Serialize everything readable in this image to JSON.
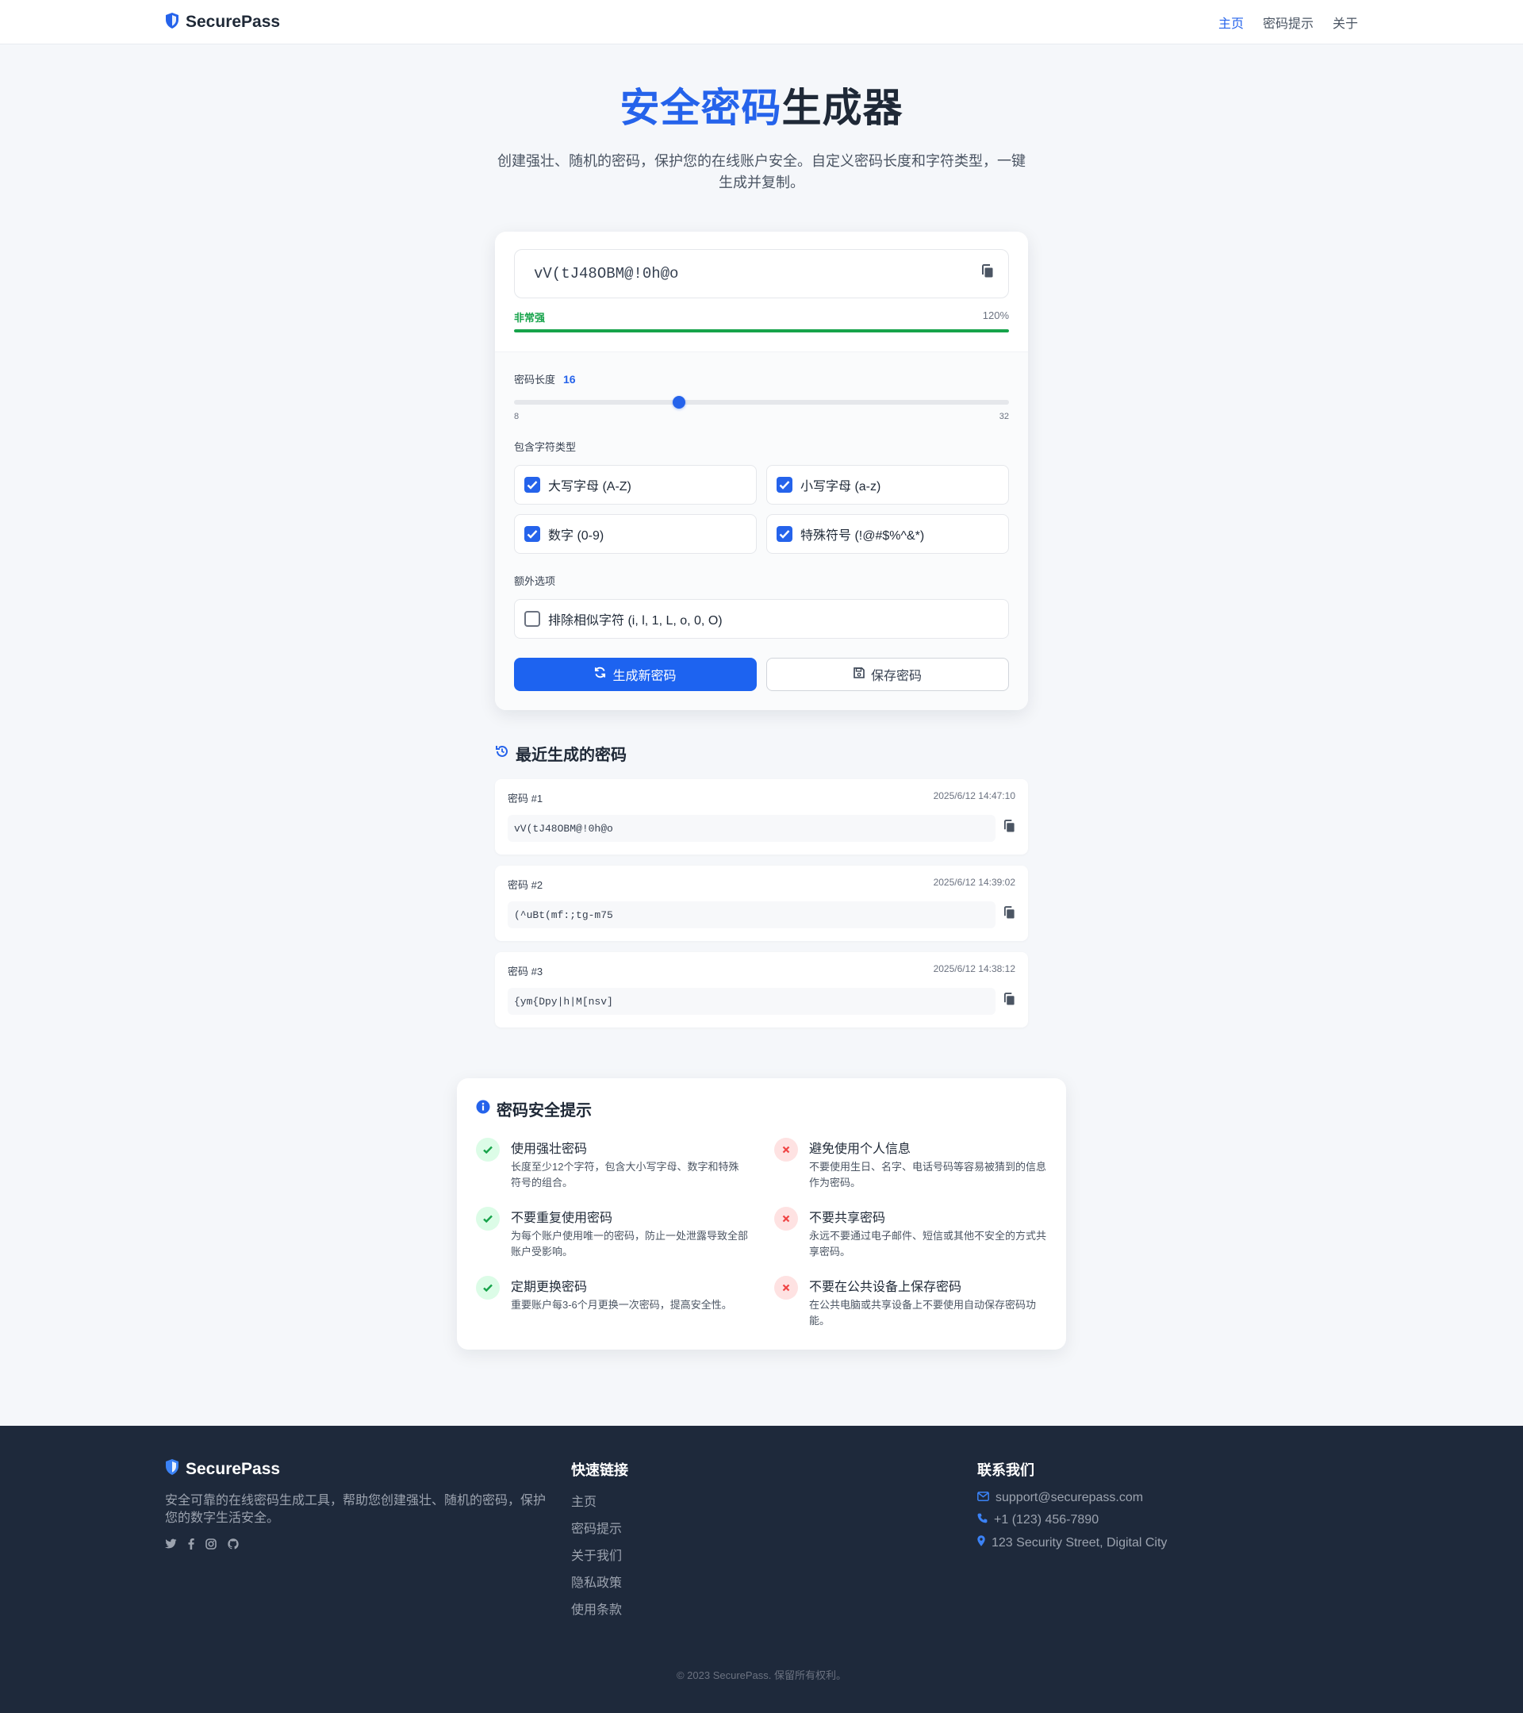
{
  "header": {
    "brand": "SecurePass",
    "nav": [
      {
        "label": "主页"
      },
      {
        "label": "密码提示"
      },
      {
        "label": "关于"
      }
    ]
  },
  "hero": {
    "title_highlight": "安全密码",
    "title_rest": "生成器",
    "subtitle": "创建强壮、随机的密码，保护您的在线账户安全。自定义密码长度和字符类型，一键生成并复制。"
  },
  "generator": {
    "password": "vV(tJ48OBM@!0h@o",
    "strength_label": "非常强",
    "strength_percent": "120%",
    "strength_fill_fraction": 1.0,
    "length_label": "密码长度",
    "length_value": "16",
    "length_min": "8",
    "length_max": "32",
    "charset_label": "包含字符类型",
    "options": [
      {
        "label": "大写字母 (A-Z)",
        "checked": true
      },
      {
        "label": "小写字母 (a-z)",
        "checked": true
      },
      {
        "label": "数字 (0-9)",
        "checked": true
      },
      {
        "label": "特殊符号 (!@#$%^&*)",
        "checked": true
      }
    ],
    "extra_label": "额外选项",
    "extra_option": {
      "label": "排除相似字符 (i, l, 1, L, o, 0, O)",
      "checked": false
    },
    "generate_label": "生成新密码",
    "save_label": "保存密码"
  },
  "recent": {
    "title": "最近生成的密码",
    "items": [
      {
        "name": "密码 #1",
        "time": "2025/6/12 14:47:10",
        "password": "vV(tJ48OBM@!0h@o"
      },
      {
        "name": "密码 #2",
        "time": "2025/6/12 14:39:02",
        "password": "(^uBt(mf:;tg-m75"
      },
      {
        "name": "密码 #3",
        "time": "2025/6/12 14:38:12",
        "password": "{ym{Dpy|h|M[nsv]"
      }
    ]
  },
  "tips": {
    "title": "密码安全提示",
    "items": [
      {
        "type": "good",
        "head": "使用强壮密码",
        "desc": "长度至少12个字符，包含大小写字母、数字和特殊符号的组合。"
      },
      {
        "type": "bad",
        "head": "避免使用个人信息",
        "desc": "不要使用生日、名字、电话号码等容易被猜到的信息作为密码。"
      },
      {
        "type": "good",
        "head": "不要重复使用密码",
        "desc": "为每个账户使用唯一的密码，防止一处泄露导致全部账户受影响。"
      },
      {
        "type": "bad",
        "head": "不要共享密码",
        "desc": "永远不要通过电子邮件、短信或其他不安全的方式共享密码。"
      },
      {
        "type": "good",
        "head": "定期更换密码",
        "desc": "重要账户每3-6个月更换一次密码，提高安全性。"
      },
      {
        "type": "bad",
        "head": "不要在公共设备上保存密码",
        "desc": "在公共电脑或共享设备上不要使用自动保存密码功能。"
      }
    ]
  },
  "footer": {
    "brand": "SecurePass",
    "desc": "安全可靠的在线密码生成工具，帮助您创建强壮、随机的密码，保护您的数字生活安全。",
    "links_title": "快速链接",
    "links": [
      "主页",
      "密码提示",
      "关于我们",
      "隐私政策",
      "使用条款"
    ],
    "contact_title": "联系我们",
    "email": "support@securepass.com",
    "phone": "+1 (123) 456-7890",
    "address": "123 Security Street, Digital City",
    "copyright": "© 2023 SecurePass. 保留所有权利。"
  },
  "colors": {
    "accent": "#2563eb",
    "strong": "#16a34a",
    "danger": "#ef4444",
    "footer_bg": "#1e293b"
  },
  "icons": {
    "brand": "shield-icon",
    "copy": "copy-icon",
    "refresh": "refresh-icon",
    "save": "floppy-icon",
    "history": "history-icon",
    "info": "info-icon",
    "good": "check-icon",
    "bad": "x-icon"
  }
}
